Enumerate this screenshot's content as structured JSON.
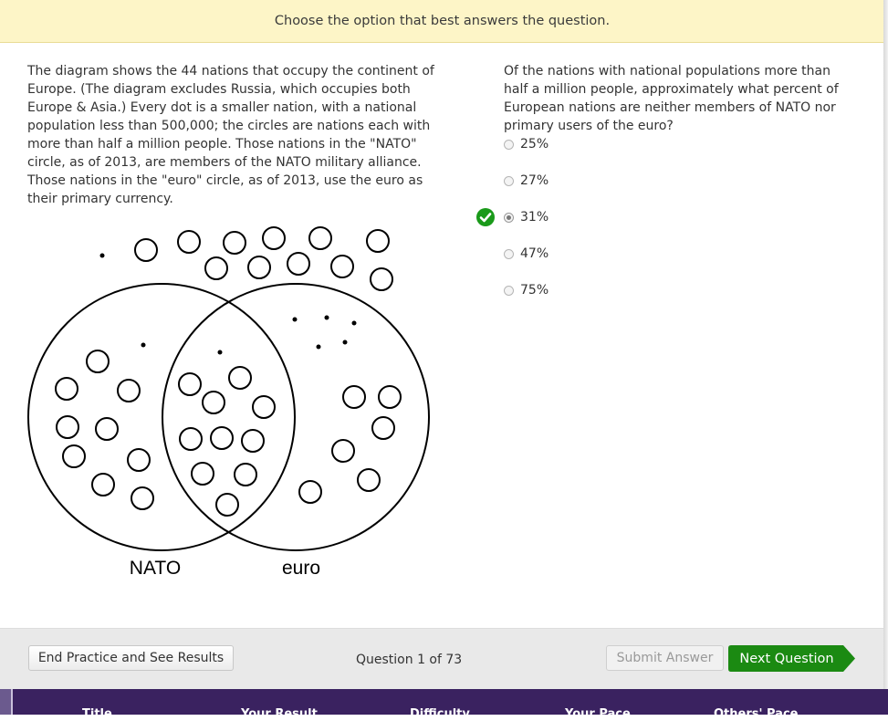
{
  "banner": {
    "text": "Choose the option that best answers the question."
  },
  "passage": {
    "text": "The diagram shows the 44 nations that occupy the continent of Europe.  (The diagram excludes Russia, which occupies both Europe & Asia.)  Every dot is a smaller nation, with a national population less than 500,000; the circles are nations each with more than half a million people.  Those nations in the \"NATO\" circle, as of 2013, are members of the NATO military alliance.  Those nations in the \"euro\" circle, as of 2013, use the euro as their primary currency."
  },
  "diagram": {
    "label_nato": "NATO",
    "label_euro": "euro"
  },
  "question": {
    "text": "Of the nations with national populations more than half a million people, approximately what percent of European nations are neither members of NATO nor primary users of the euro?"
  },
  "choices": [
    {
      "label": "25%",
      "selected": false
    },
    {
      "label": "27%",
      "selected": false
    },
    {
      "label": "31%",
      "selected": true
    },
    {
      "label": "47%",
      "selected": false
    },
    {
      "label": "75%",
      "selected": false
    }
  ],
  "feedback": {
    "icon": "check-circle-icon",
    "color": "#1a9a1a"
  },
  "footer": {
    "end_button": "End Practice and See Results",
    "counter": "Question 1 of 73",
    "submit_button": "Submit Answer",
    "next_button": "Next Question",
    "next_color": "#1b8a12"
  },
  "bottom_bar": {
    "columns": [
      "Title",
      "Your Result",
      "Difficulty",
      "Your Pace",
      "Others' Pace"
    ],
    "color": "#3a2260"
  }
}
